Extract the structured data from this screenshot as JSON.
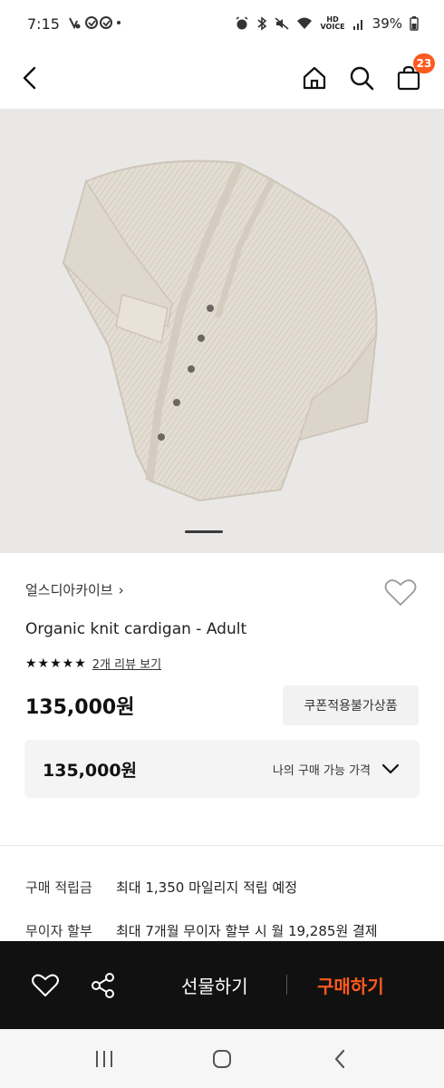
{
  "status_bar": {
    "time": "7:15",
    "battery": "39%",
    "hd_voice": "HD\nVOICE"
  },
  "header": {
    "cart_count": "23",
    "icons": [
      "back-icon",
      "home-icon",
      "search-icon",
      "shopping-bag-icon"
    ]
  },
  "product": {
    "brand": "얼스디아카이브",
    "brand_chevron": "›",
    "title": "Organic knit cardigan - Adult",
    "rating_stars": "★★★★★",
    "rating_value": 5,
    "review_link": "2개 리뷰 보기",
    "price": "135,000원",
    "coupon_badge": "쿠폰적용불가상품",
    "my_price_value": "135,000원",
    "my_price_label": "나의 구매 가능 가격"
  },
  "benefits": [
    {
      "label": "구매 적립금",
      "value": "최대 1,350 마일리지 적립 예정"
    },
    {
      "label": "무이자 할부",
      "value": "최대 7개월 무이자 할부 시 월 19,285원 결제"
    }
  ],
  "action_bar": {
    "gift_label": "선물하기",
    "buy_label": "구매하기"
  },
  "colors": {
    "accent": "#ff5a1f",
    "action_bar_bg": "#111111",
    "image_bg": "#e9e8e6"
  }
}
